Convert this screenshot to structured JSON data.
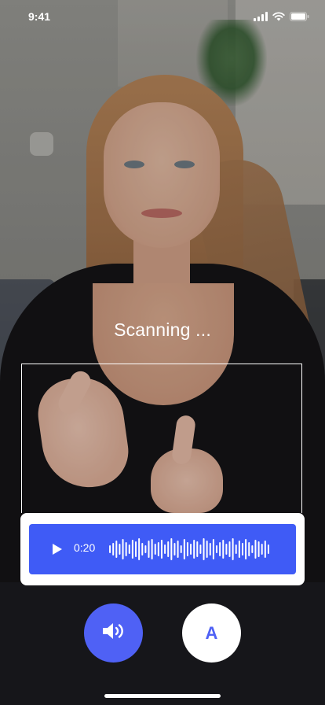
{
  "status_bar": {
    "time": "9:41",
    "icons": [
      "cellular-signal-icon",
      "wifi-icon",
      "battery-icon"
    ]
  },
  "scanning": {
    "label": "Scanning ..."
  },
  "audio_player": {
    "play_icon": "play-icon",
    "time": "0:20",
    "waveform_bars": [
      10,
      16,
      22,
      14,
      26,
      18,
      12,
      24,
      20,
      28,
      16,
      10,
      22,
      26,
      14,
      18,
      24,
      12,
      20,
      28,
      16,
      22,
      10,
      26,
      18,
      14,
      24,
      20,
      12,
      28,
      22,
      16,
      26,
      10,
      18,
      24,
      14,
      20,
      28,
      12,
      22,
      16,
      26,
      18,
      10,
      24,
      20,
      14,
      22,
      12
    ]
  },
  "controls": {
    "speaker_icon": "speaker-icon",
    "text_button_label": "A"
  },
  "colors": {
    "accent": "#3f5bf6",
    "button_primary": "#4f61f5",
    "card": "#ffffff"
  }
}
